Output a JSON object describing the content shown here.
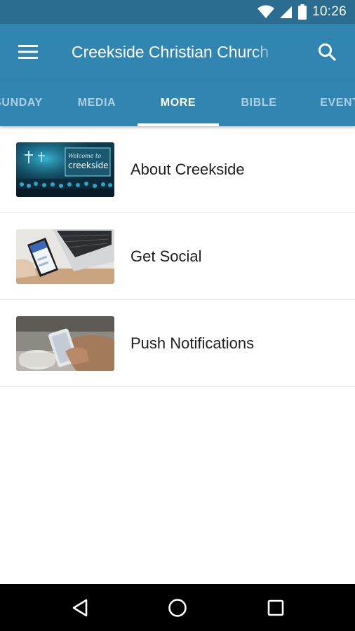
{
  "status_bar": {
    "time": "10:26"
  },
  "app_bar": {
    "title": "Creekside Christian Church",
    "menu_icon": "hamburger-menu-icon",
    "search_icon": "search-icon"
  },
  "tabs": [
    {
      "label": "SUNDAY",
      "active": false
    },
    {
      "label": "MEDIA",
      "active": false
    },
    {
      "label": "MORE",
      "active": true
    },
    {
      "label": "BIBLE",
      "active": false
    },
    {
      "label": "EVENTS",
      "active": false
    }
  ],
  "list": [
    {
      "label": "About Creekside",
      "thumb_icon": "church-stage-image",
      "thumb_text": "creekside",
      "thumb_script": "Welcome to"
    },
    {
      "label": "Get Social",
      "thumb_icon": "phone-laptop-image"
    },
    {
      "label": "Push Notifications",
      "thumb_icon": "phone-in-hand-image"
    }
  ],
  "nav_bar": {
    "back_icon": "back-triangle-icon",
    "home_icon": "home-circle-icon",
    "recents_icon": "recents-square-icon"
  },
  "colors": {
    "status_bar": "#2a6d90",
    "app_bar": "#3186b1",
    "tab_active": "#ffffff",
    "tab_inactive": "#9cc3d8"
  }
}
